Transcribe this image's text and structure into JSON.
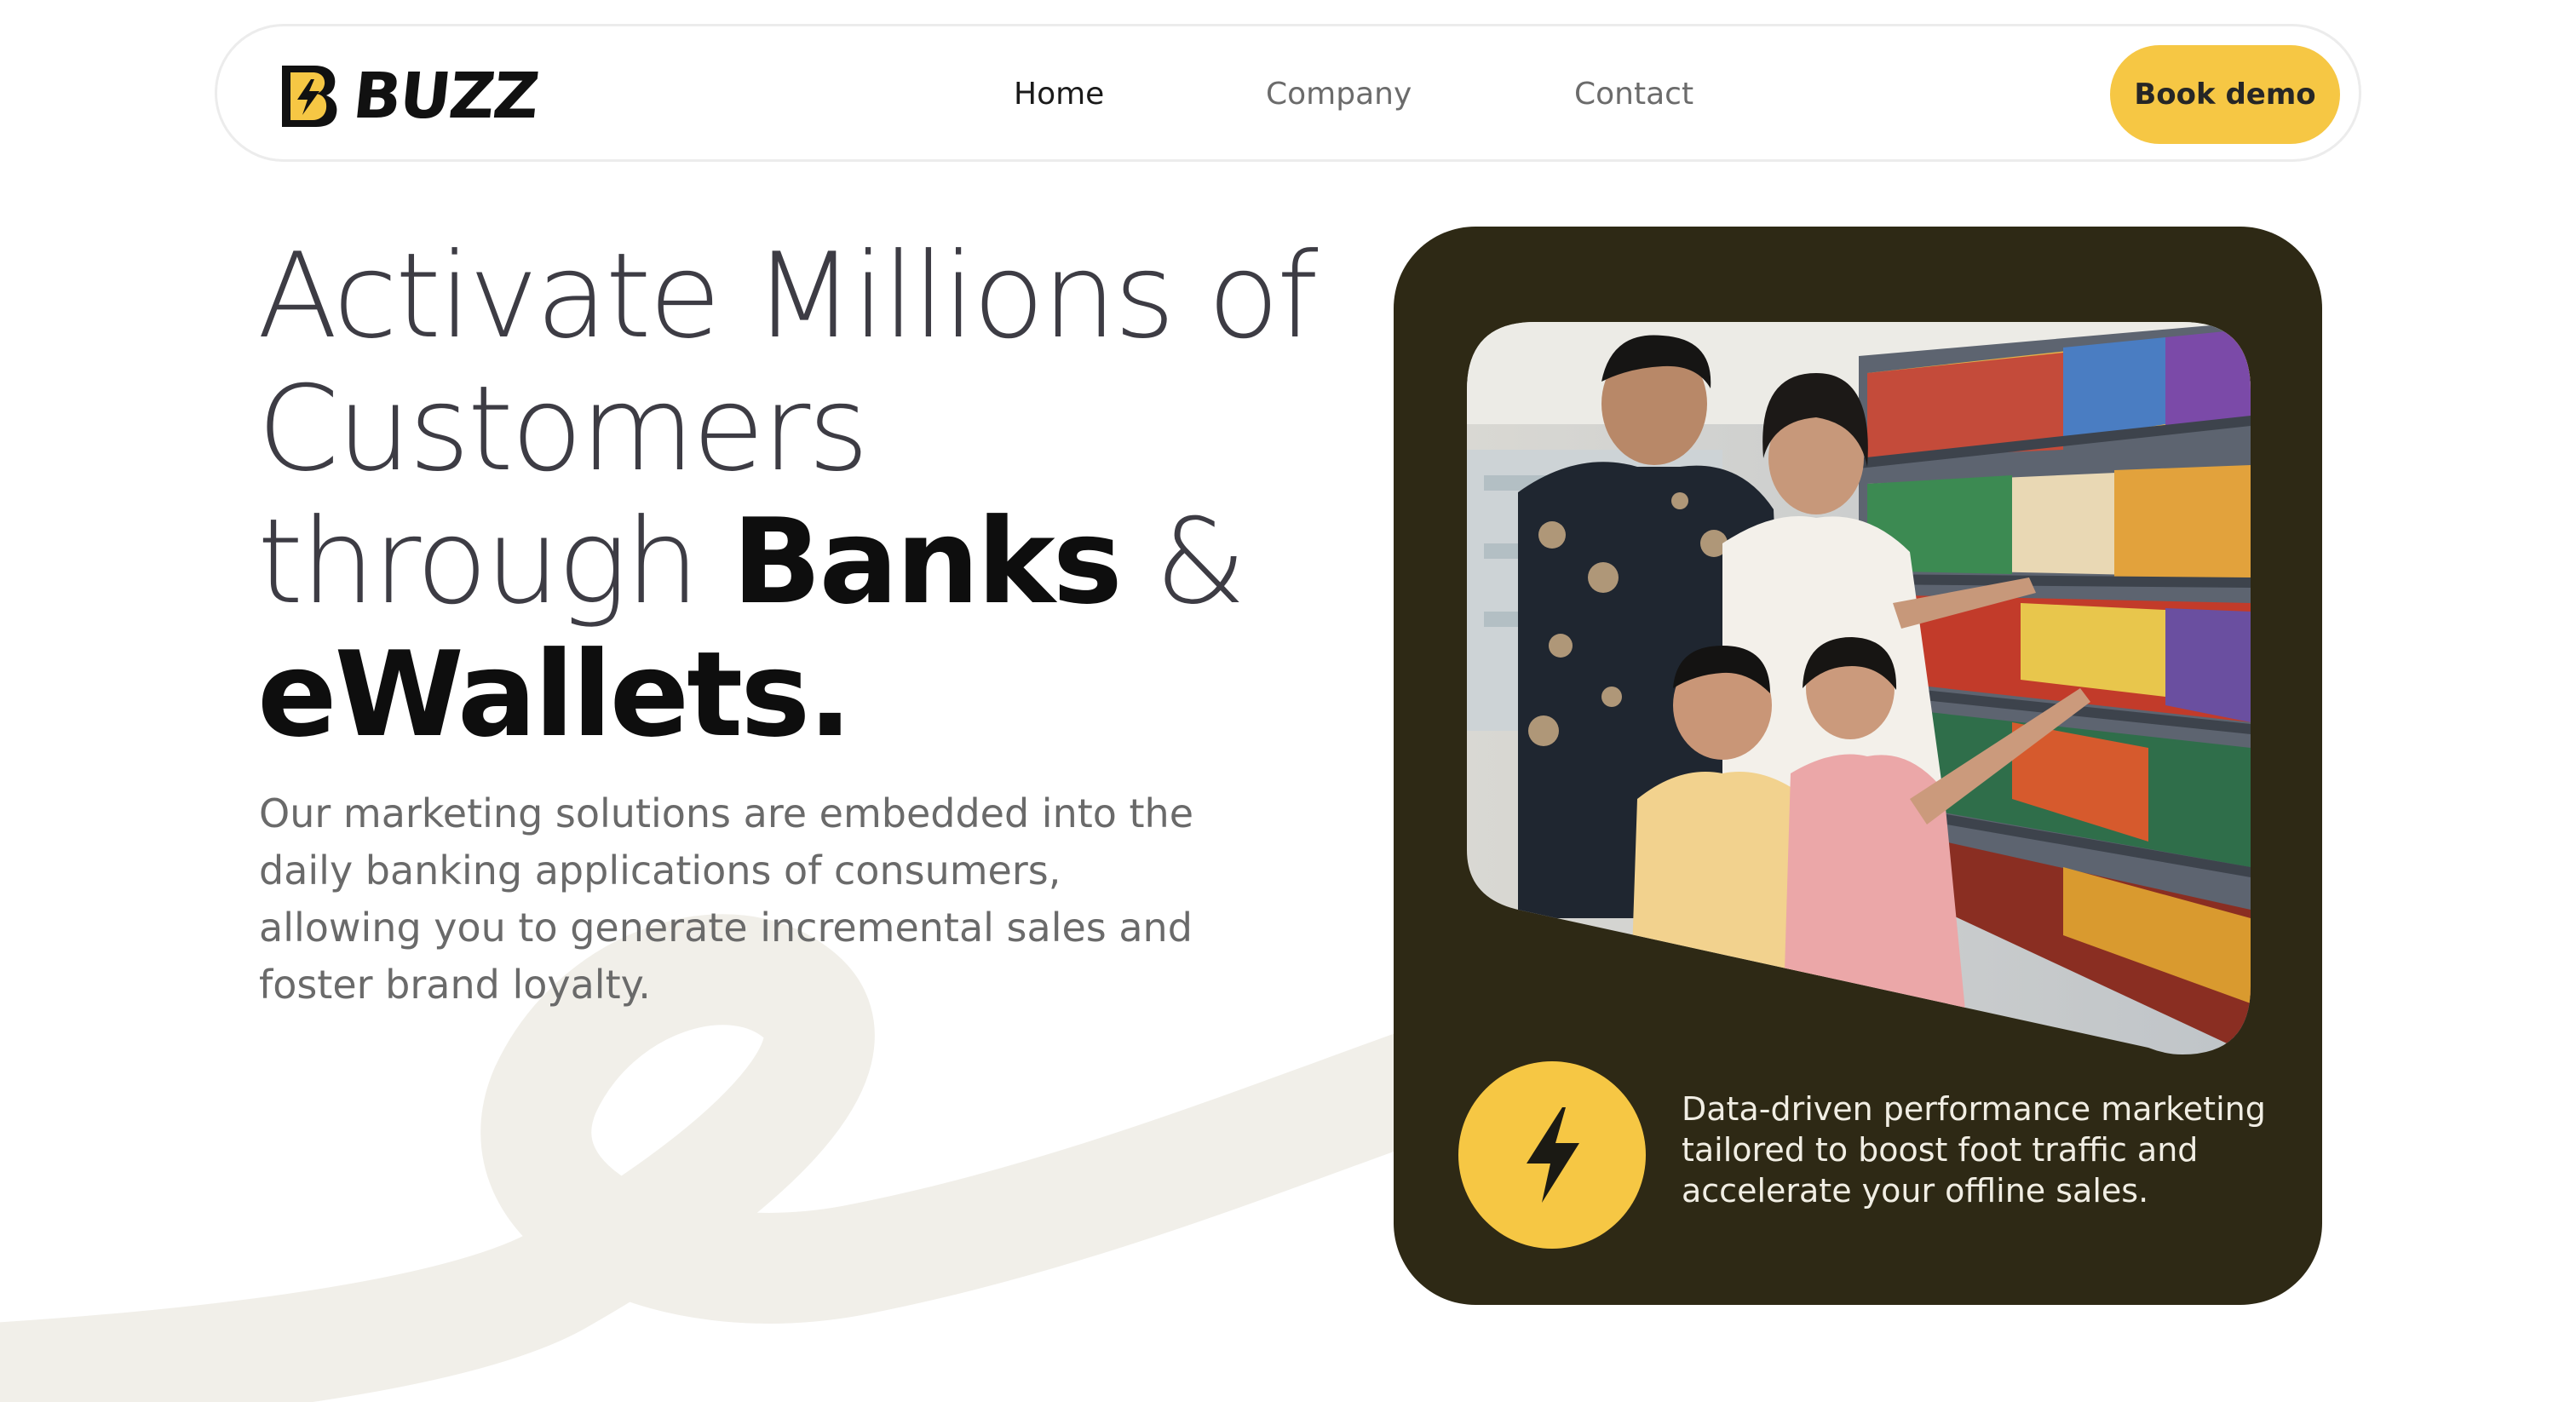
{
  "brand": {
    "name": "BUZZ",
    "logo_icon": "lightning-b-icon",
    "accent_color": "#f6c744",
    "dark_color": "#2e2915"
  },
  "nav": {
    "links": [
      {
        "label": "Home",
        "active": true
      },
      {
        "label": "Company",
        "active": false
      },
      {
        "label": "Contact",
        "active": false
      }
    ],
    "cta_label": "Book demo"
  },
  "hero": {
    "title_lines": [
      "Activate Millions of",
      "Customers",
      "through ",
      "Banks",
      " &",
      "eWallets."
    ],
    "description": "Our marketing solutions are embedded into the daily banking applications of consumers, allowing you to generate incremental sales and foster brand loyalty."
  },
  "card": {
    "image_subject": "family-shopping-in-supermarket",
    "icon": "lightning-bolt-icon",
    "text": "Data-driven performance marketing tailored to boost foot traffic and accelerate your offline sales."
  }
}
